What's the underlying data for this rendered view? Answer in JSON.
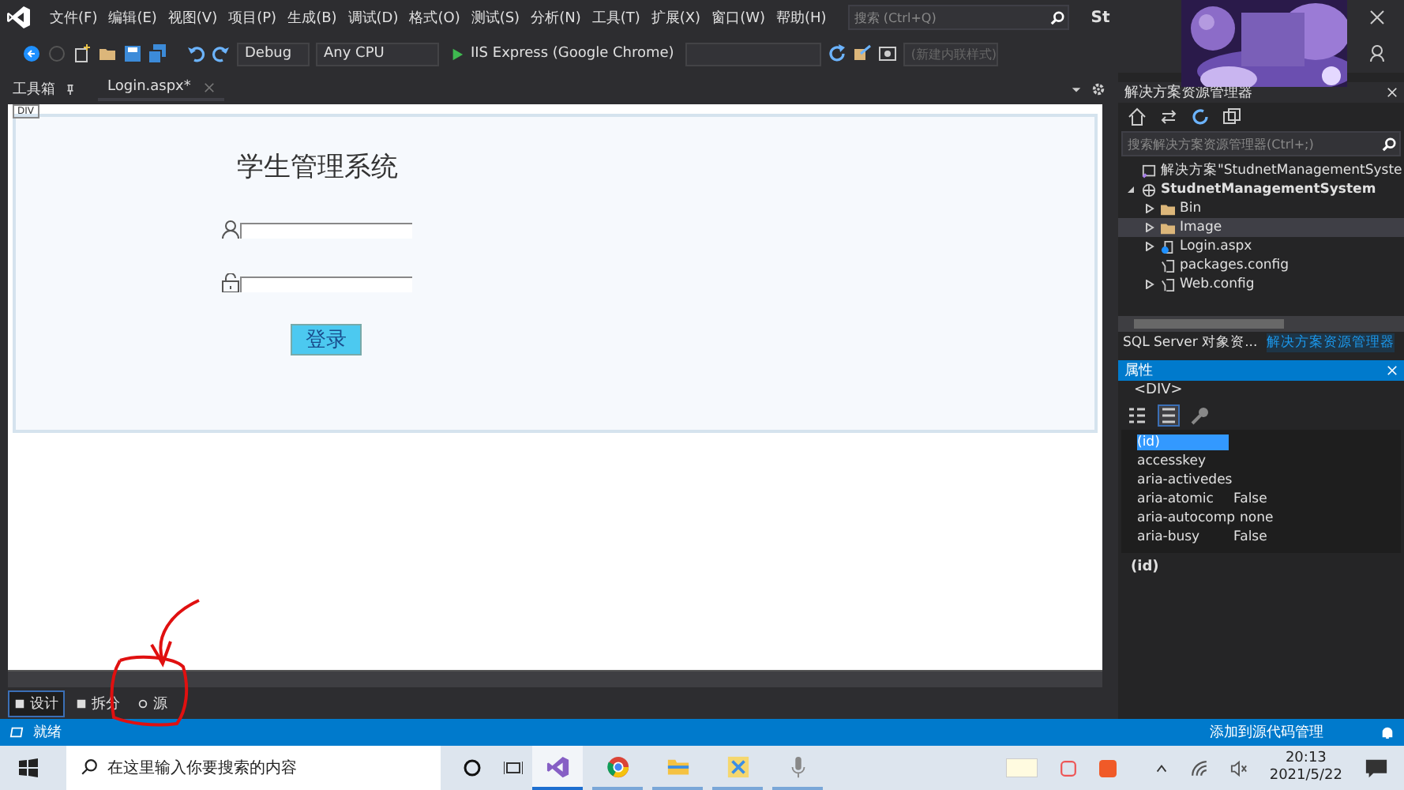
{
  "menu": {
    "items": [
      "文件(F)",
      "编辑(E)",
      "视图(V)",
      "项目(P)",
      "生成(B)",
      "调试(D)",
      "格式(O)",
      "测试(S)",
      "分析(N)",
      "工具(T)",
      "扩展(X)",
      "窗口(W)",
      "帮助(H)"
    ],
    "search": {
      "placeholder": "搜索 (Ctrl+Q)"
    },
    "window_title": "St"
  },
  "toolbar": {
    "configuration": "Debug",
    "platform": "Any CPU",
    "run_target": "IIS Express (Google Chrome)",
    "style_box": {
      "value": "(新建内联样式)",
      "disabled": true
    }
  },
  "tool_tab": "工具箱",
  "doc_tab": {
    "label": "Login.aspx*"
  },
  "design": {
    "tag": "DIV",
    "title": "学生管理系统",
    "fields": [
      {
        "kind": "user"
      },
      {
        "kind": "password"
      }
    ],
    "login_button": "登录"
  },
  "view_tabs": [
    {
      "label": "设计",
      "selected": true
    },
    {
      "label": "拆分",
      "selected": false
    },
    {
      "label": "源",
      "selected": false
    }
  ],
  "solution_explorer": {
    "title": "解决方案资源管理器",
    "search": {
      "placeholder": "搜索解决方案资源管理器(Ctrl+;)"
    },
    "tree": [
      {
        "label": "解决方案\"StudnetManagementSyste",
        "kind": "solution",
        "selected": false
      },
      {
        "label": "StudnetManagementSystem",
        "kind": "project",
        "expanded": true,
        "selected": false,
        "children": [
          {
            "label": "Bin",
            "kind": "folder",
            "expanded": false,
            "selected": false
          },
          {
            "label": "Image",
            "kind": "folder",
            "expanded": false,
            "selected": true
          },
          {
            "label": "Login.aspx",
            "kind": "page",
            "expanded": false,
            "selected": false
          },
          {
            "label": "packages.config",
            "kind": "config",
            "selected": false
          },
          {
            "label": "Web.config",
            "kind": "config",
            "expanded": false,
            "selected": false
          }
        ]
      }
    ],
    "bottom_tabs": [
      {
        "label": "SQL Server 对象资...",
        "selected": false
      },
      {
        "label": "解决方案资源管理器",
        "selected": true
      }
    ]
  },
  "properties": {
    "title": "属性",
    "object": "<DIV>",
    "rows": [
      {
        "name": "(id)",
        "selected": true
      },
      {
        "name": "accesskey",
        "selected": false
      },
      {
        "name": "aria-activedes",
        "selected": false
      },
      {
        "name": "aria-atomic",
        "value": "False",
        "selected": false
      },
      {
        "name": "aria-autocomp",
        "value": "none",
        "selected": false
      },
      {
        "name": "aria-busy",
        "value": "False",
        "selected": false
      }
    ],
    "description": "(id)"
  },
  "status_bar": {
    "text": "就绪",
    "source_control": "添加到源代码管理"
  },
  "taskbar": {
    "search": {
      "placeholder": "在这里输入你要搜索的内容"
    },
    "apps": [
      {
        "kind": "vs",
        "active": true
      },
      {
        "kind": "chrome",
        "active": false
      },
      {
        "kind": "folder",
        "active": false
      },
      {
        "kind": "tool",
        "active": false
      },
      {
        "kind": "mic",
        "active": false
      }
    ],
    "time": "20:13",
    "date": "2021/5/22"
  }
}
